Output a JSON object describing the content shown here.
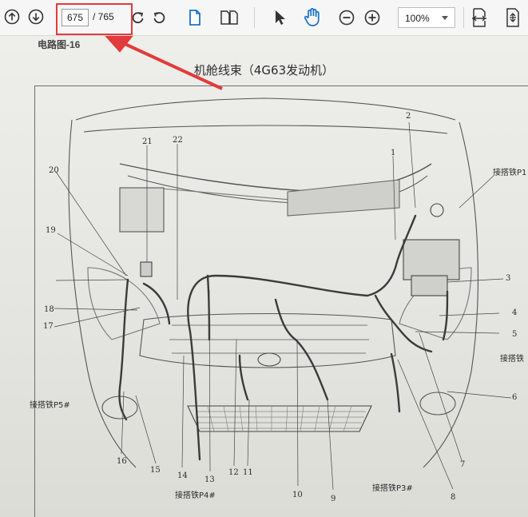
{
  "toolbar": {
    "current_page": "675",
    "total_pages": "/ 765",
    "zoom": "100%",
    "icons": [
      "arrow-up-circle-icon",
      "arrow-down-circle-icon",
      "rotate-clockwise-icon",
      "rotate-counterclockwise-icon",
      "single-page-icon",
      "two-page-icon",
      "select-cursor-icon",
      "hand-pan-icon",
      "zoom-out-icon",
      "zoom-in-icon",
      "fit-page-icon",
      "fit-width-icon"
    ],
    "accent_color": "#1a73c8",
    "annotation_color": "#e23b3b"
  },
  "document": {
    "header": "电路图-16",
    "title": "机舱线束（4G63发动机）",
    "callouts": [
      "1",
      "2",
      "3",
      "4",
      "5",
      "6",
      "7",
      "8",
      "9",
      "10",
      "11",
      "12",
      "13",
      "14",
      "15",
      "16",
      "17",
      "18",
      "19",
      "20",
      "21",
      "22"
    ],
    "ground_labels": {
      "p1": "接搭铁P1",
      "p2": "接搭铁",
      "p3": "接搭铁P3#",
      "p4": "接搭铁P4#",
      "p5": "接搭铁P5#"
    }
  }
}
